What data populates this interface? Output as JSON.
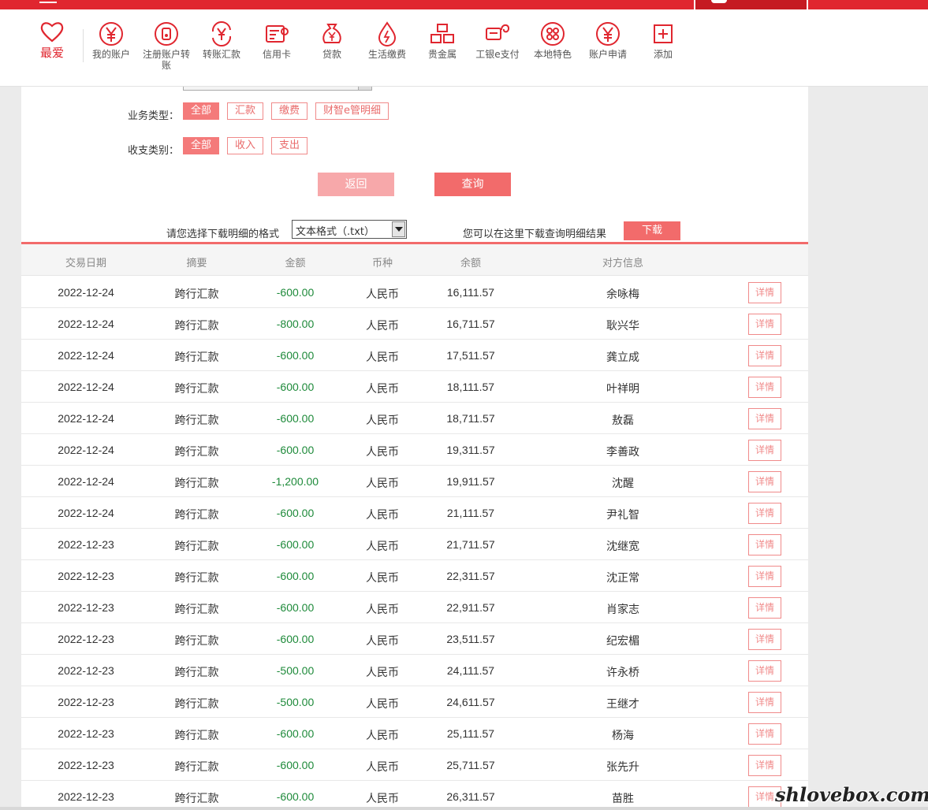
{
  "nav": {
    "favorite": "最爱",
    "items": [
      {
        "label": "我的账户",
        "icon": "yen-circle-icon"
      },
      {
        "label": "注册账户转账",
        "icon": "account-transfer-icon"
      },
      {
        "label": "转账汇款",
        "icon": "transfer-remit-icon"
      },
      {
        "label": "信用卡",
        "icon": "credit-card-icon"
      },
      {
        "label": "贷款",
        "icon": "money-bag-icon"
      },
      {
        "label": "生活缴费",
        "icon": "water-drop-icon"
      },
      {
        "label": "贵金属",
        "icon": "gold-bars-icon"
      },
      {
        "label": "工银e支付",
        "icon": "e-pay-icon"
      },
      {
        "label": "本地特色",
        "icon": "local-feature-icon"
      },
      {
        "label": "账户申请",
        "icon": "account-apply-icon"
      },
      {
        "label": "添加",
        "icon": "plus-square-icon"
      }
    ]
  },
  "filters": {
    "business_type_label": "业务类型：",
    "business_types": [
      "全部",
      "汇款",
      "缴费",
      "财智e管明细"
    ],
    "io_type_label": "收支类别：",
    "io_types": [
      "全部",
      "收入",
      "支出"
    ]
  },
  "buttons": {
    "back": "返回",
    "query": "查询"
  },
  "download": {
    "prompt": "请您选择下载明细的格式",
    "format": "文本格式（.txt）",
    "tip": "您可以在这里下载查询明细结果",
    "button": "下载"
  },
  "table": {
    "headers": [
      "交易日期",
      "摘要",
      "金额",
      "币种",
      "余额",
      "对方信息"
    ],
    "detail_label": "详情",
    "rows": [
      [
        "2022-12-24",
        "跨行汇款",
        "-600.00",
        "人民币",
        "16,111.57",
        "余咏梅"
      ],
      [
        "2022-12-24",
        "跨行汇款",
        "-800.00",
        "人民币",
        "16,711.57",
        "耿兴华"
      ],
      [
        "2022-12-24",
        "跨行汇款",
        "-600.00",
        "人民币",
        "17,511.57",
        "龚立成"
      ],
      [
        "2022-12-24",
        "跨行汇款",
        "-600.00",
        "人民币",
        "18,111.57",
        "叶祥明"
      ],
      [
        "2022-12-24",
        "跨行汇款",
        "-600.00",
        "人民币",
        "18,711.57",
        "敖磊"
      ],
      [
        "2022-12-24",
        "跨行汇款",
        "-600.00",
        "人民币",
        "19,311.57",
        "李善政"
      ],
      [
        "2022-12-24",
        "跨行汇款",
        "-1,200.00",
        "人民币",
        "19,911.57",
        "沈醒"
      ],
      [
        "2022-12-24",
        "跨行汇款",
        "-600.00",
        "人民币",
        "21,111.57",
        "尹礼智"
      ],
      [
        "2022-12-23",
        "跨行汇款",
        "-600.00",
        "人民币",
        "21,711.57",
        "沈继宽"
      ],
      [
        "2022-12-23",
        "跨行汇款",
        "-600.00",
        "人民币",
        "22,311.57",
        "沈正常"
      ],
      [
        "2022-12-23",
        "跨行汇款",
        "-600.00",
        "人民币",
        "22,911.57",
        "肖家志"
      ],
      [
        "2022-12-23",
        "跨行汇款",
        "-600.00",
        "人民币",
        "23,511.57",
        "纪宏楣"
      ],
      [
        "2022-12-23",
        "跨行汇款",
        "-500.00",
        "人民币",
        "24,111.57",
        "许永桥"
      ],
      [
        "2022-12-23",
        "跨行汇款",
        "-500.00",
        "人民币",
        "24,611.57",
        "王继才"
      ],
      [
        "2022-12-23",
        "跨行汇款",
        "-600.00",
        "人民币",
        "25,111.57",
        "杨海"
      ],
      [
        "2022-12-23",
        "跨行汇款",
        "-600.00",
        "人民币",
        "25,711.57",
        "张先升"
      ],
      [
        "2022-12-23",
        "跨行汇款",
        "-600.00",
        "人民币",
        "26,311.57",
        "苗胜"
      ]
    ]
  },
  "watermark": "shlovebox.com",
  "colors": {
    "brand_red": "#e0262f",
    "accent_pink": "#f26b6b",
    "amount_green": "#1e8a3a"
  }
}
